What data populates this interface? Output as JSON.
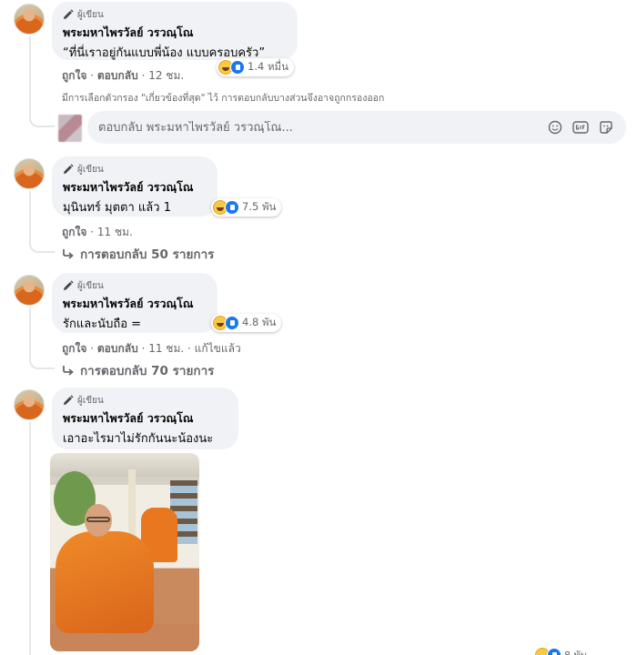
{
  "author_badge": "ผู้เขียน",
  "comments": [
    {
      "name": "พระมหาไพรวัลย์ วรวณฺโณ",
      "text": "“ที่นี่เราอยู่กันแบบพี่น้อง แบบครอบครัว”",
      "reactions": "1.4 หมื่น",
      "actions": {
        "like": "ถูกใจ",
        "reply": "ตอบกลับ",
        "time": "12 ชม."
      }
    },
    {
      "name": "พระมหาไพรวัลย์ วรวณฺโณ",
      "text": "มุนินทร์ มุตตา แล้ว 1",
      "reactions": "7.5 พัน",
      "actions": {
        "like": "ถูกใจ",
        "time": "11 ชม."
      },
      "replies_link": "การตอบกลับ 50 รายการ"
    },
    {
      "name": "พระมหาไพรวัลย์ วรวณฺโณ",
      "text": "รักและนับถือ =",
      "reactions": "4.8 พัน",
      "actions": {
        "like": "ถูกใจ",
        "reply": "ตอบกลับ",
        "time": "11 ชม.",
        "edited": "แก้ไขแล้ว"
      },
      "replies_link": "การตอบกลับ 70 รายการ"
    },
    {
      "name": "พระมหาไพรวัลย์ วรวณฺโณ",
      "text": "เอาอะไรมาไม่รักกันนะน้องนะ",
      "reactions": "8 พัน"
    }
  ],
  "filter_note": "มีการเลือกตัวกรอง \"เกี่ยวข้องที่สุด\" ไว้ การตอบกลับบางส่วนจึงอาจถูกกรองออก",
  "reply_box": {
    "placeholder": "ตอบกลับ พระมหาไพรวัลย์ วรวณฺโณ..."
  },
  "icons": [
    "pencil-icon",
    "haha-reaction-icon",
    "like-reaction-icon",
    "reply-arrow-icon",
    "emoji-icon",
    "gif-icon",
    "sticker-icon"
  ],
  "colors": {
    "bubble": "#f0f2f5",
    "secondary_text": "#65676b",
    "like_blue": "#1877f2",
    "haha_yellow": "#f7c948",
    "thread_line": "#e4e6eb"
  }
}
